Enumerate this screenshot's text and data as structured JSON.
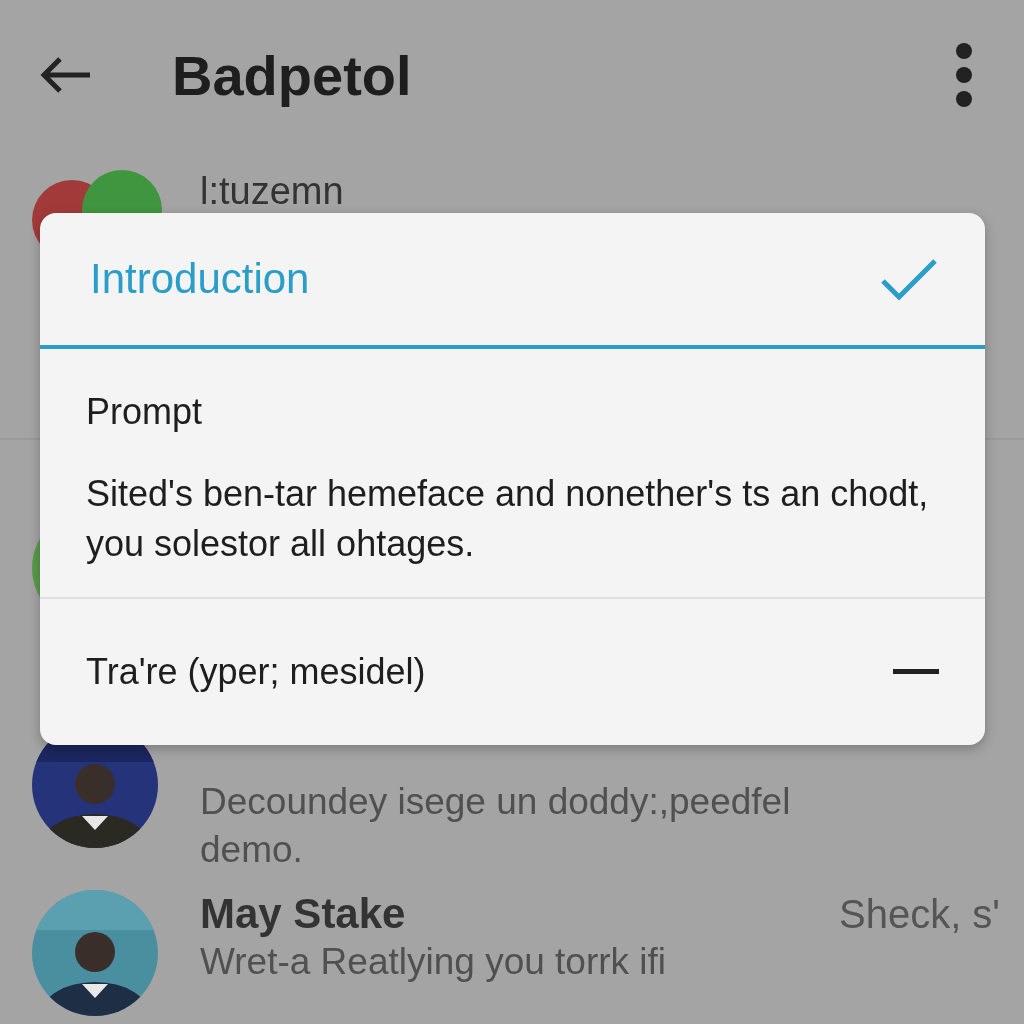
{
  "app_bar": {
    "title": "Badpetol"
  },
  "list": [
    {
      "kind": "dots",
      "title": "l:tuzemn"
    },
    {
      "kind": "green"
    },
    {
      "description": "Decoundey isege un doddy:,peedfel demo."
    },
    {
      "title": "May Stake",
      "time": "Sheck, s'",
      "description": "Wret-a Reatlying you torrk ifi"
    }
  ],
  "dialog": {
    "title": "Introduction",
    "checked": true,
    "heading": "Prompt",
    "body": "Sited's ben-tar hemeface and nonether's ts an chodt, you solestor all ohtages.",
    "items": [
      {
        "label": "Tra're (yper; mesidel)",
        "kind": "minus"
      }
    ]
  }
}
